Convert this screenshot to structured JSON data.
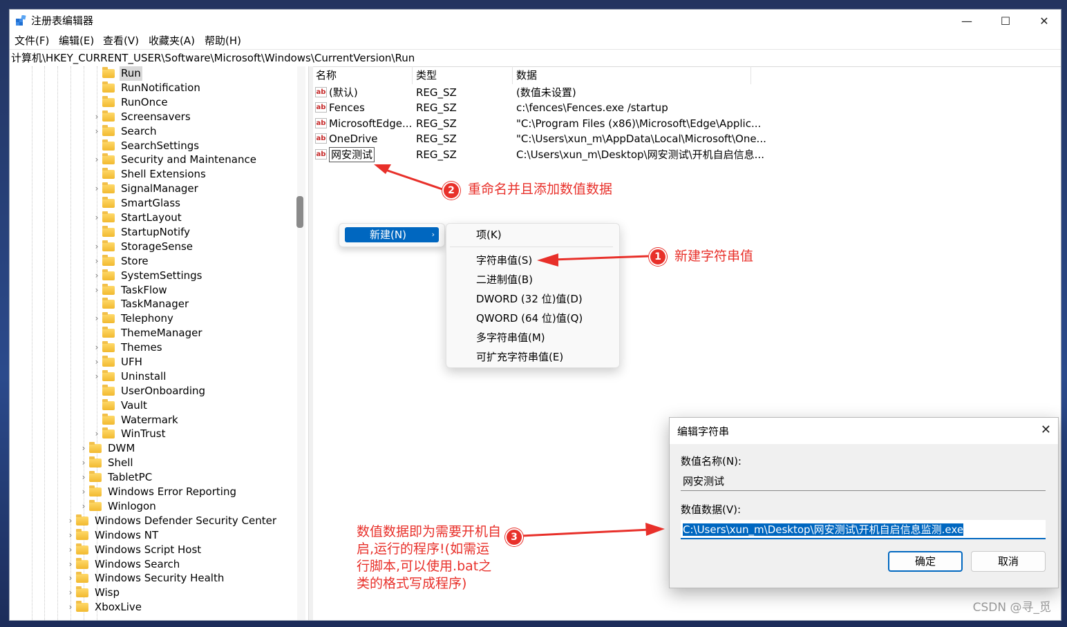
{
  "window": {
    "title": "注册表编辑器",
    "minimize": "—",
    "maximize": "☐",
    "close": "✕"
  },
  "menu": [
    "文件(F)",
    "编辑(E)",
    "查看(V)",
    "收藏夹(A)",
    "帮助(H)"
  ],
  "address": "计算机\\HKEY_CURRENT_USER\\Software\\Microsoft\\Windows\\CurrentVersion\\Run",
  "tree": {
    "level3": [
      "Run",
      "RunNotification",
      "RunOnce",
      "Screensavers",
      "Search",
      "SearchSettings",
      "Security and Maintenance",
      "Shell Extensions",
      "SignalManager",
      "SmartGlass",
      "StartLayout",
      "StartupNotify",
      "StorageSense",
      "Store",
      "SystemSettings",
      "TaskFlow",
      "TaskManager",
      "Telephony",
      "ThemeManager",
      "Themes",
      "UFH",
      "Uninstall",
      "UserOnboarding",
      "Vault",
      "Watermark",
      "WinTrust"
    ],
    "level2": [
      "DWM",
      "Shell",
      "TabletPC",
      "Windows Error Reporting",
      "Winlogon"
    ],
    "level1": [
      "Windows Defender Security Center",
      "Windows NT",
      "Windows Script Host",
      "Windows Search",
      "Windows Security Health",
      "Wisp",
      "XboxLive"
    ]
  },
  "values": {
    "headers": {
      "name": "名称",
      "type": "类型",
      "data": "数据"
    },
    "icon_text": "ab",
    "rows": [
      {
        "name": "(默认)",
        "type": "REG_SZ",
        "data": "(数值未设置)"
      },
      {
        "name": "Fences",
        "type": "REG_SZ",
        "data": "c:\\fences\\Fences.exe /startup"
      },
      {
        "name": "MicrosoftEdge...",
        "type": "REG_SZ",
        "data": "\"C:\\Program Files (x86)\\Microsoft\\Edge\\Applic..."
      },
      {
        "name": "OneDrive",
        "type": "REG_SZ",
        "data": "\"C:\\Users\\xun_m\\AppData\\Local\\Microsoft\\One..."
      },
      {
        "name": "网安测试",
        "type": "REG_SZ",
        "data": "C:\\Users\\xun_m\\Desktop\\网安测试\\开机自启信息..."
      }
    ]
  },
  "context_menu": {
    "new_label": "新建(N)",
    "submenu": [
      "项(K)",
      "字符串值(S)",
      "二进制值(B)",
      "DWORD (32 位)值(D)",
      "QWORD (64 位)值(Q)",
      "多字符串值(M)",
      "可扩充字符串值(E)"
    ]
  },
  "annotations": {
    "step1": {
      "num": "1",
      "text": "新建字符串值"
    },
    "step2": {
      "num": "2",
      "text": "重命名并且添加数值数据"
    },
    "step3": {
      "num": "3",
      "text": "数值数据即为需要开机自启,运行的程序!(如需运行脚本,可以使用.bat之类的格式写成程序)"
    },
    "color": "#e8302a"
  },
  "dialog": {
    "title": "编辑字符串",
    "name_label": "数值名称(N):",
    "name_value": "网安测试",
    "data_label": "数值数据(V):",
    "data_value": "C:\\Users\\xun_m\\Desktop\\网安测试\\开机自启信息监测.exe",
    "ok": "确定",
    "cancel": "取消"
  },
  "watermark": "CSDN @寻_觅"
}
